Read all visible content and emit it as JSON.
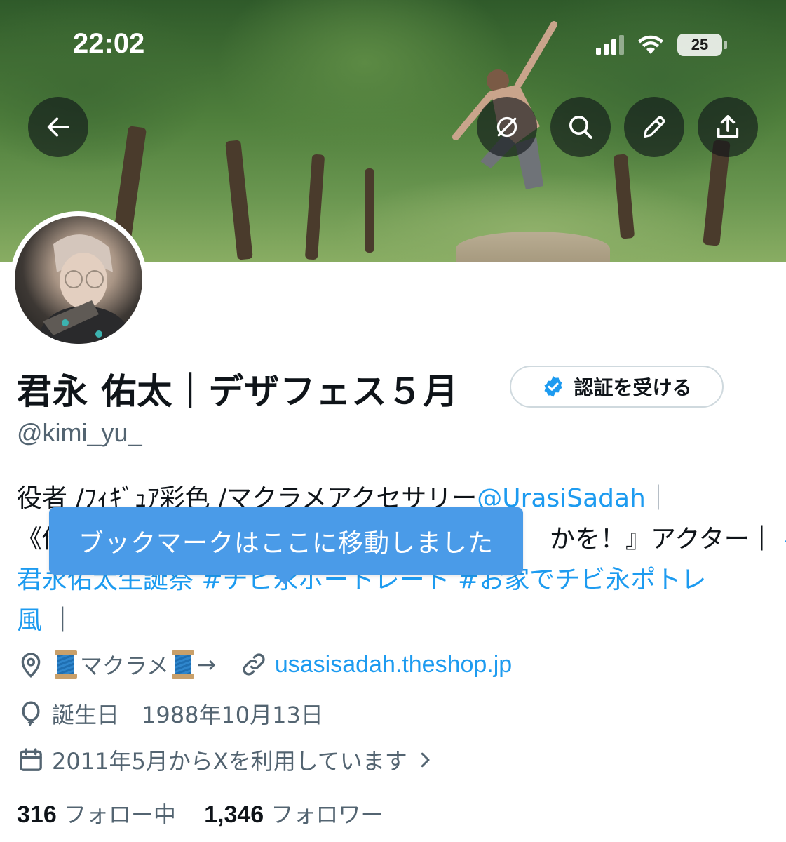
{
  "status_bar": {
    "time": "22:02",
    "battery": "25"
  },
  "header": {
    "back_icon": "arrow-left-icon",
    "actions": [
      "no-translate-icon",
      "search-icon",
      "pencil-icon",
      "share-icon"
    ]
  },
  "profile": {
    "display_name": "君永 佑太｜デザフェス５月",
    "handle": "@kimi_yu_",
    "verify_button": "認証を受ける",
    "bio": {
      "line1_text": "役者 /ﾌｨｷﾞｭｱ彩色 /マクラメアクセサリー",
      "line1_link": "@UrasiSadah",
      "line1_end": "｜",
      "line2_start": "《他",
      "line2_end": "かを！』アクター｜",
      "line2_hashtag": "#",
      "line3_hashtags": "君永佑太生誕祭 #チビ永ポートレート #お家でチビ永ポトレ",
      "line4_hashtag": "風",
      "line4_end": "｜"
    },
    "location": {
      "before": "マクラメ",
      "after": "→"
    },
    "website": "usasisadah.theshop.jp",
    "birthday": "誕生日　1988年10月13日",
    "joined": "2011年5月からXを利用しています",
    "following_count": "316",
    "following_label": "フォロー中",
    "followers_count": "1,346",
    "followers_label": "フォロワー"
  },
  "toast": {
    "message": "ブックマークはここに移動しました"
  },
  "colors": {
    "accent": "#1d9bf0",
    "toast": "#4a9be8",
    "muted": "#536471"
  }
}
